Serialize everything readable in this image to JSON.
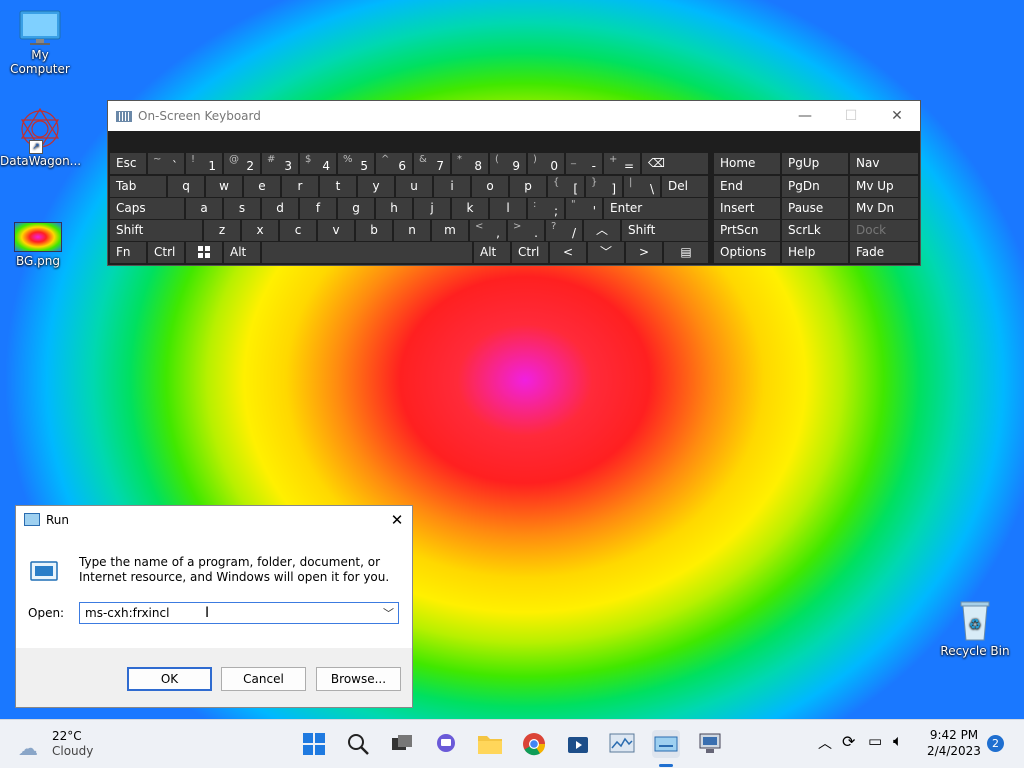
{
  "desktop": {
    "icons": {
      "my_computer": "My Computer",
      "datawagon": "DataWagon...",
      "bg": "BG.png",
      "recycle": "Recycle Bin"
    }
  },
  "osk": {
    "title": "On-Screen Keyboard",
    "keys": {
      "esc": "Esc",
      "tab": "Tab",
      "caps": "Caps",
      "shift": "Shift",
      "fn": "Fn",
      "ctrl": "Ctrl",
      "alt": "Alt",
      "del": "Del",
      "enter": "Enter",
      "rshift": "Shift",
      "ralt": "Alt",
      "rctrl": "Ctrl",
      "home": "Home",
      "pgup": "PgUp",
      "nav": "Nav",
      "end": "End",
      "pgdn": "PgDn",
      "mvup": "Mv Up",
      "insert": "Insert",
      "pause": "Pause",
      "mvdn": "Mv Dn",
      "prtscn": "PrtScn",
      "scrlk": "ScrLk",
      "dock": "Dock",
      "options": "Options",
      "help": "Help",
      "fade": "Fade"
    }
  },
  "run": {
    "title": "Run",
    "message": "Type the name of a program, folder, document, or Internet resource, and Windows will open it for you.",
    "open_label": "Open:",
    "value": "ms-cxh:frxincl",
    "ok": "OK",
    "cancel": "Cancel",
    "browse": "Browse..."
  },
  "taskbar": {
    "weather_temp": "22°C",
    "weather_desc": "Cloudy",
    "time": "9:42 PM",
    "date": "2/4/2023",
    "notifications": "2"
  }
}
